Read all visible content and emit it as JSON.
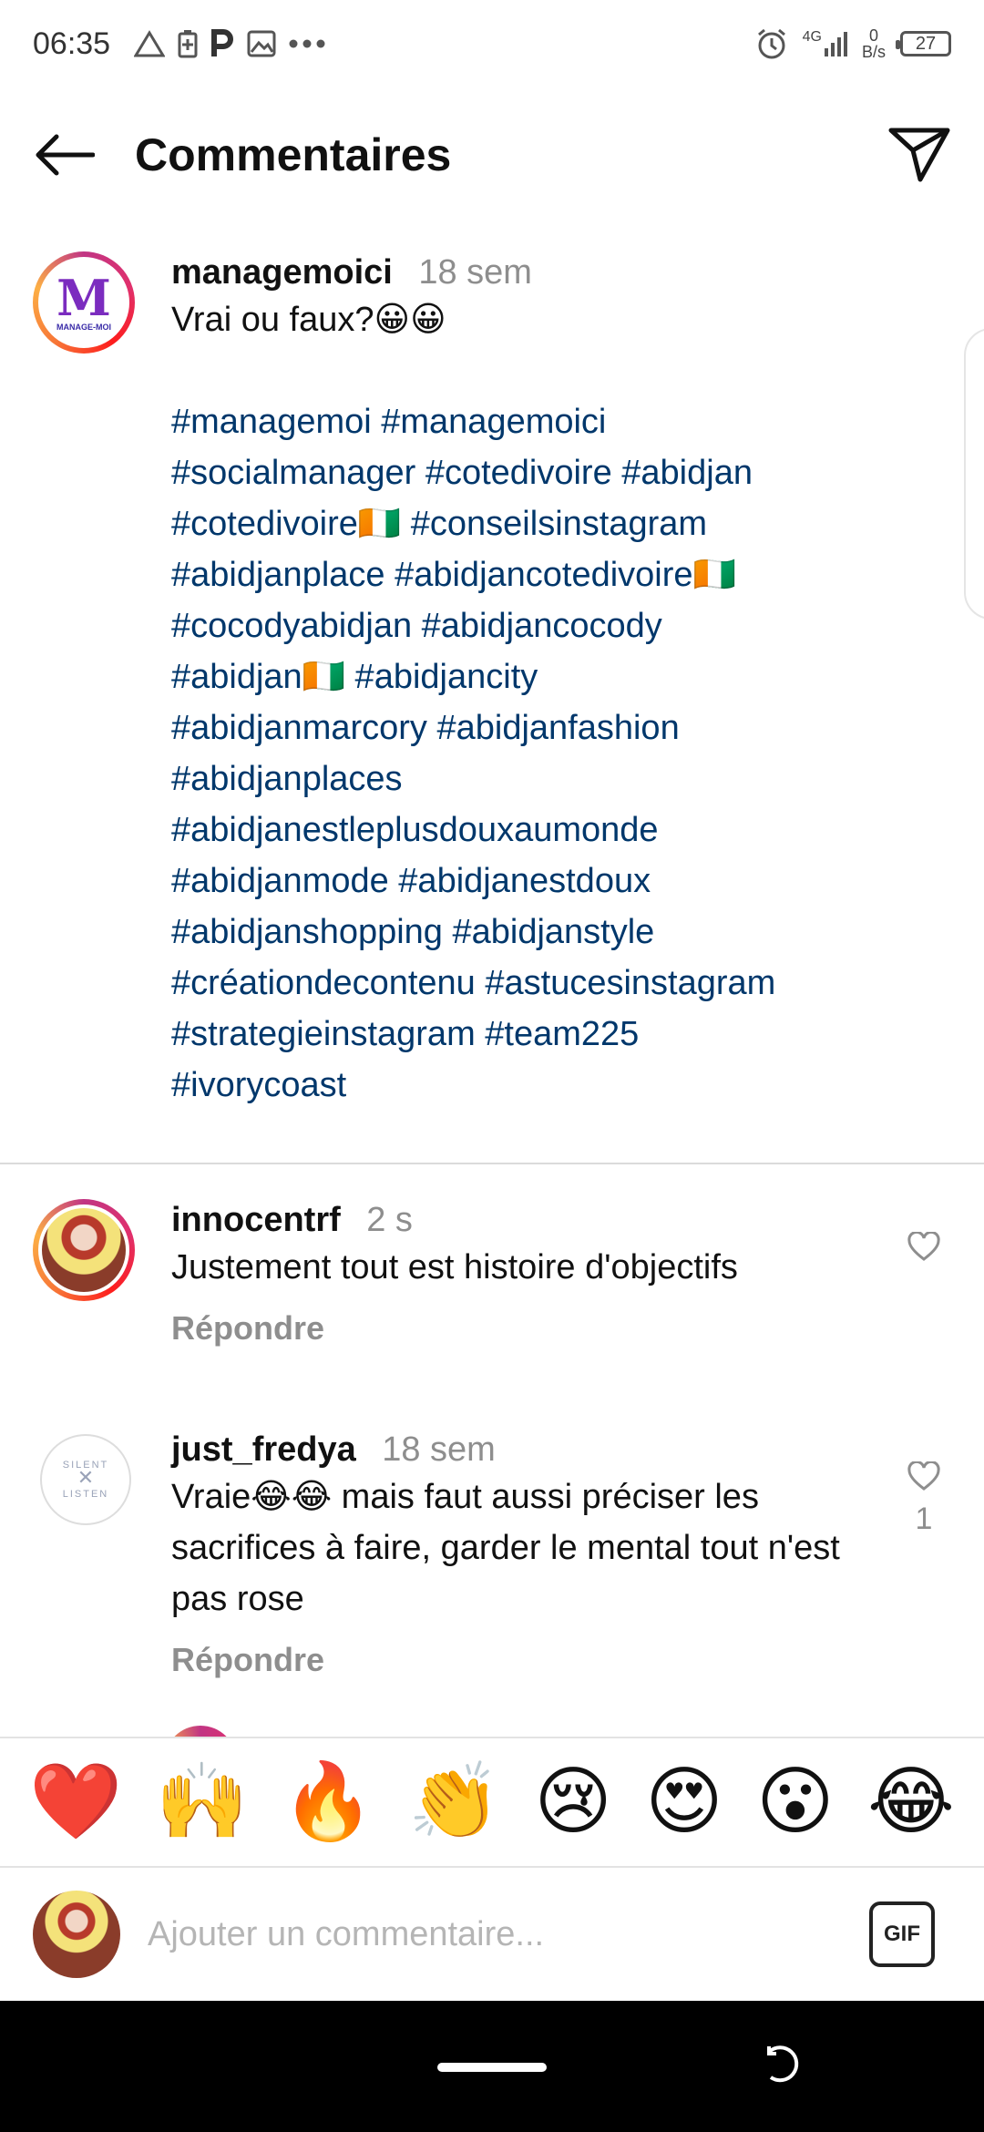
{
  "status_bar": {
    "time": "06:35",
    "network": "4G",
    "rate_value": "0",
    "rate_unit": "B/s",
    "battery": "27"
  },
  "header": {
    "title": "Commentaires"
  },
  "caption": {
    "username": "managemoici",
    "time": "18 sem",
    "text": "Vrai ou faux?😀😀",
    "hashtags": "#managemoi #managemoici\n#socialmanager #cotedivoire #abidjan\n#cotedivoire🇨🇮 #conseilsinstagram\n#abidjanplace #abidjancotedivoire🇨🇮\n#cocodyabidjan #abidjancocody\n#abidjan🇨🇮 #abidjancity\n#abidjanmarcory #abidjanfashion\n#abidjanplaces\n#abidjanestleplusdouxaumonde\n#abidjanmode #abidjanestdoux\n#abidjanshopping #abidjanstyle\n#créationdecontenu #astucesinstagram\n#strategieinstagram #team225\n#ivorycoast",
    "avatar_letter": "M",
    "avatar_text": "MANAGE-MOI"
  },
  "comments": [
    {
      "username": "innocentrf",
      "time": "2 s",
      "text": "Justement tout est histoire d'objectifs",
      "reply_label": "Répondre",
      "likes": ""
    },
    {
      "username": "just_fredya",
      "time": "18 sem",
      "text": "Vraie😂😂 mais faut aussi préciser les sacrifices à faire, garder le mental tout n'est pas rose",
      "reply_label": "Répondre",
      "likes": "1",
      "avatar_text_1": "SILENT",
      "avatar_text_2": "LISTEN"
    }
  ],
  "emoji_bar": [
    "❤️",
    "🙌",
    "🔥",
    "👏",
    "😢",
    "😍",
    "😮",
    "😂"
  ],
  "compose": {
    "placeholder": "Ajouter un commentaire...",
    "gif_label": "GIF"
  },
  "icons": {
    "back": "arrow-left-icon",
    "send": "paper-plane-icon",
    "heart": "heart-outline-icon"
  }
}
